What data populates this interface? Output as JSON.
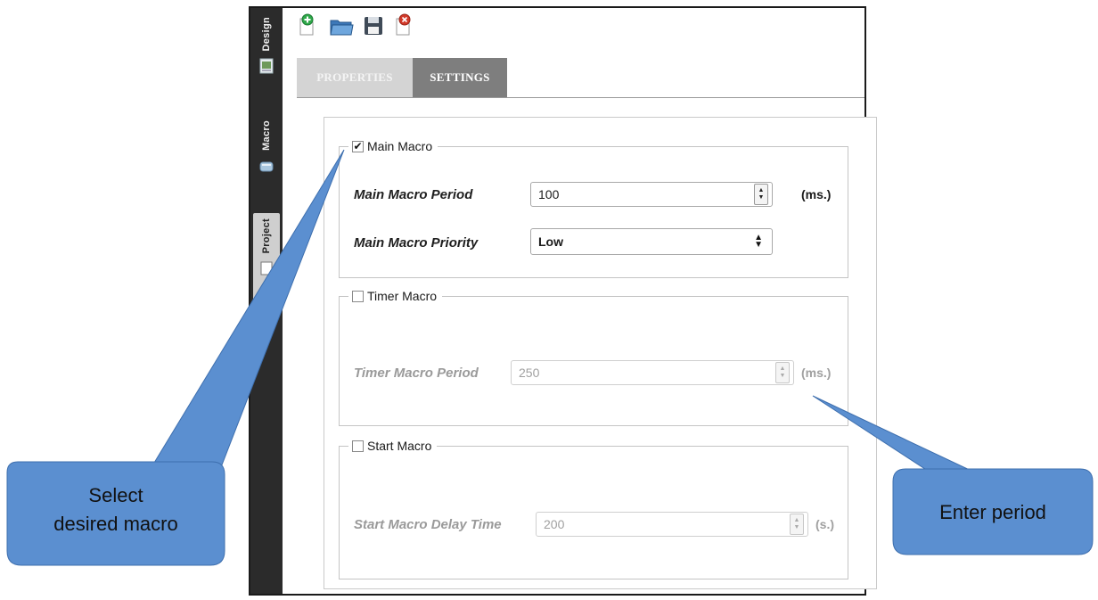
{
  "sidebar": {
    "tabs": [
      {
        "label": "Design"
      },
      {
        "label": "Macro"
      },
      {
        "label": "Project"
      }
    ]
  },
  "toolbar": {
    "icons": [
      "new-document-icon",
      "open-folder-icon",
      "save-icon",
      "delete-document-icon"
    ]
  },
  "tabs": {
    "properties": "PROPERTIES",
    "settings": "SETTINGS"
  },
  "main_macro": {
    "legend": "Main Macro",
    "checked": true,
    "period_label": "Main Macro Period",
    "period_value": "100",
    "period_unit": "(ms.)",
    "priority_label": "Main Macro Priority",
    "priority_value": "Low"
  },
  "timer_macro": {
    "legend": "Timer Macro",
    "checked": false,
    "period_label": "Timer Macro Period",
    "period_value": "250",
    "period_unit": "(ms.)"
  },
  "start_macro": {
    "legend": "Start Macro",
    "checked": false,
    "delay_label": "Start Macro Delay Time",
    "delay_value": "200",
    "delay_unit": "(s.)"
  },
  "callouts": {
    "select_macro_line1": "Select",
    "select_macro_line2": "desired macro",
    "enter_period": "Enter period"
  },
  "colors": {
    "callout_fill": "#5b8fd0",
    "settings_tab": "#7e7e7e",
    "properties_tab": "#d4d4d4",
    "rail": "#2b2b2b"
  }
}
